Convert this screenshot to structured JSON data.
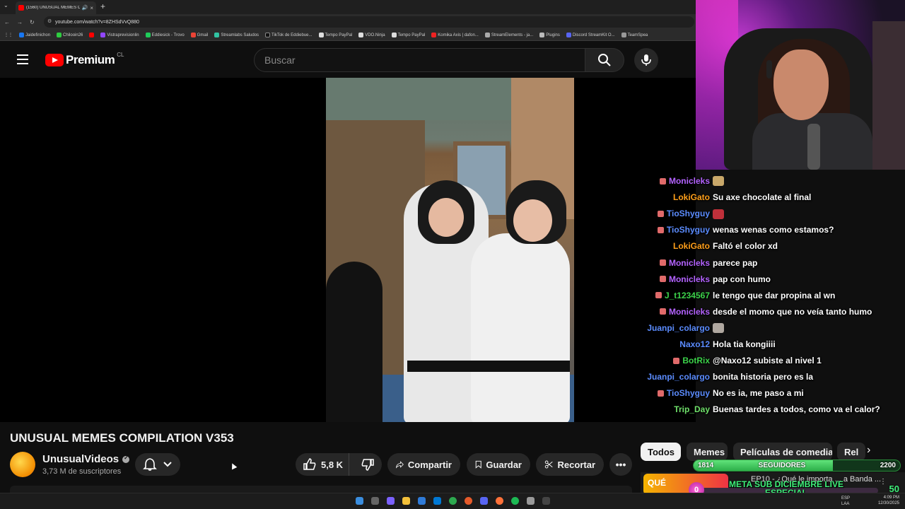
{
  "browser": {
    "tab_title": "(1560) UNUSUAL MEMES C",
    "url": "youtube.com/watch?v=8ZHSdVvQ880",
    "bookmarks": [
      "Jaidefinichon",
      "Chilooin26",
      "Vistraprevisionlin",
      "Eddiesick - Trovo",
      "Gmail",
      "Streamlabs Saludos",
      "TikTok de Eddiebue...",
      "Tempo PayPal",
      "VDO.Ninja",
      "Tempo PayPal",
      "Komika Axis | dafon...",
      "StreamElements - ja...",
      "Plugins",
      "Discord StreamKit O...",
      "TeamSpea"
    ]
  },
  "youtube": {
    "logo_text": "Premium",
    "country": "CL",
    "search_placeholder": "Buscar"
  },
  "video": {
    "title": "UNUSUAL MEMES COMPILATION V353",
    "channel": "UnusualVideos",
    "subscribers": "3,73 M de suscriptores",
    "likes": "5,8 K",
    "share_label": "Compartir",
    "save_label": "Guardar",
    "clip_label": "Recortar"
  },
  "chips": [
    "Todos",
    "Memes",
    "Películas de comedia",
    "Rel"
  ],
  "chat": [
    {
      "user": "Monicleks",
      "color": "#b463ff",
      "badge": true,
      "text": "",
      "emote": "#c9a86a"
    },
    {
      "user": "LokiGato",
      "color": "#ff9f1a",
      "badge": false,
      "text": "Su axe chocolate al final"
    },
    {
      "user": "TioShyguy",
      "color": "#5b8cff",
      "badge": true,
      "text": "",
      "emote": "#c0303a"
    },
    {
      "user": "TioShyguy",
      "color": "#5b8cff",
      "badge": true,
      "text": "wenas wenas como estamos?"
    },
    {
      "user": "LokiGato",
      "color": "#ff9f1a",
      "badge": false,
      "text": "Faltó el color xd"
    },
    {
      "user": "Monicleks",
      "color": "#b463ff",
      "badge": true,
      "text": "parece pap"
    },
    {
      "user": "Monicleks",
      "color": "#b463ff",
      "badge": true,
      "text": "pap con humo"
    },
    {
      "user": "J_t1234567",
      "color": "#3cd24a",
      "badge": true,
      "text": "le tengo que dar propina al wn"
    },
    {
      "user": "Monicleks",
      "color": "#b463ff",
      "badge": true,
      "text": "desde el momo que no veía tanto humo"
    },
    {
      "user": "Juanpi_colargo",
      "color": "#5b8cff",
      "badge": false,
      "text": "",
      "emote": "#b0a8a0"
    },
    {
      "user": "Naxo12",
      "color": "#5b8cff",
      "badge": false,
      "text": "Hola tia kongiiii"
    },
    {
      "user": "BotRix",
      "color": "#3cd24a",
      "badge": true,
      "text": "@Naxo12 subiste al nivel 1"
    },
    {
      "user": "Juanpi_colargo",
      "color": "#5b8cff",
      "badge": false,
      "text": "bonita historia pero es la"
    },
    {
      "user": "TioShyguy",
      "color": "#5b8cff",
      "badge": true,
      "text": "No es ia, me paso a mi"
    },
    {
      "user": "Trip_Day",
      "color": "#6fe06a",
      "badge": false,
      "text": "Buenas tardes a todos, como va el calor?"
    }
  ],
  "follower_goal": {
    "current": "1814",
    "label": "SEGUIDORES",
    "target": "2200",
    "progress": 0.82
  },
  "sub_goal": {
    "current": "0",
    "label": "META SUB DICIEMBRE LIVE ESPECIAL",
    "target": "50"
  },
  "recommended": {
    "thumb_text": "QUÉ",
    "title": "EP10 - ¿Qué le importa ... a Banda ..."
  },
  "taskbar": {
    "lang": "ESP",
    "lang2": "LAA",
    "time": "4:09 PM",
    "date": "12/30/2025"
  }
}
